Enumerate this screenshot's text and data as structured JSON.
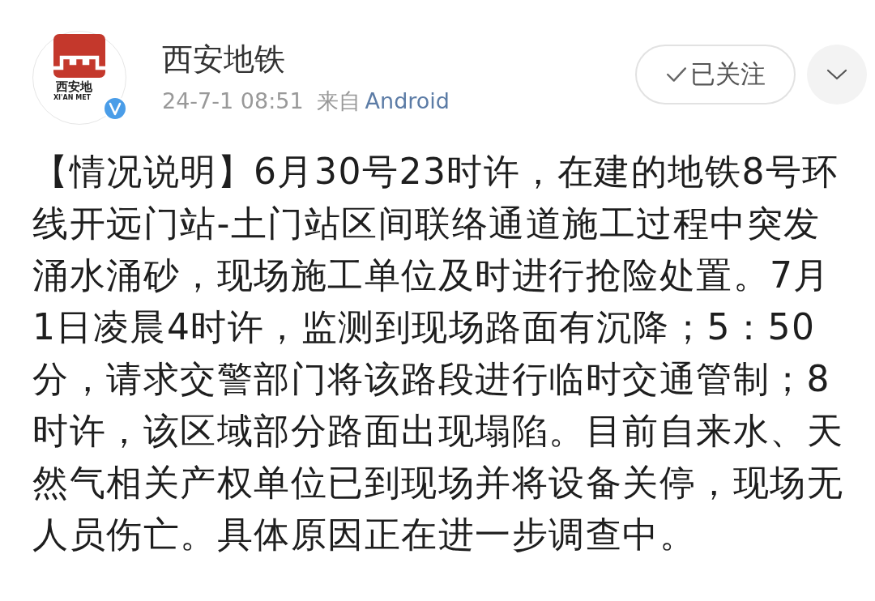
{
  "post": {
    "author": {
      "name": "西安地铁",
      "verified": true,
      "avatar_logo": {
        "text": "西安地",
        "subtext": "XI'AN MET"
      }
    },
    "time": "24-7-1 08:51",
    "source_prefix": "来自",
    "source": "Android",
    "follow_button": {
      "label": "已关注",
      "followed": true
    },
    "body": "【情况说明】6月30号23时许，在建的地铁8号环线开远门站-土门站区间联络通道施工过程中突发涌水涌砂，现场施工单位及时进行抢险处置。7月1日凌晨4时许，监测到现场路面有沉降；5：50分，请求交警部门将该路段进行临时交通管制；8时许，该区域部分路面出现塌陷。目前自来水、天然气相关产权单位已到现场并将设备关停，现场无人员伤亡。具体原因正在进一步调查中。"
  }
}
